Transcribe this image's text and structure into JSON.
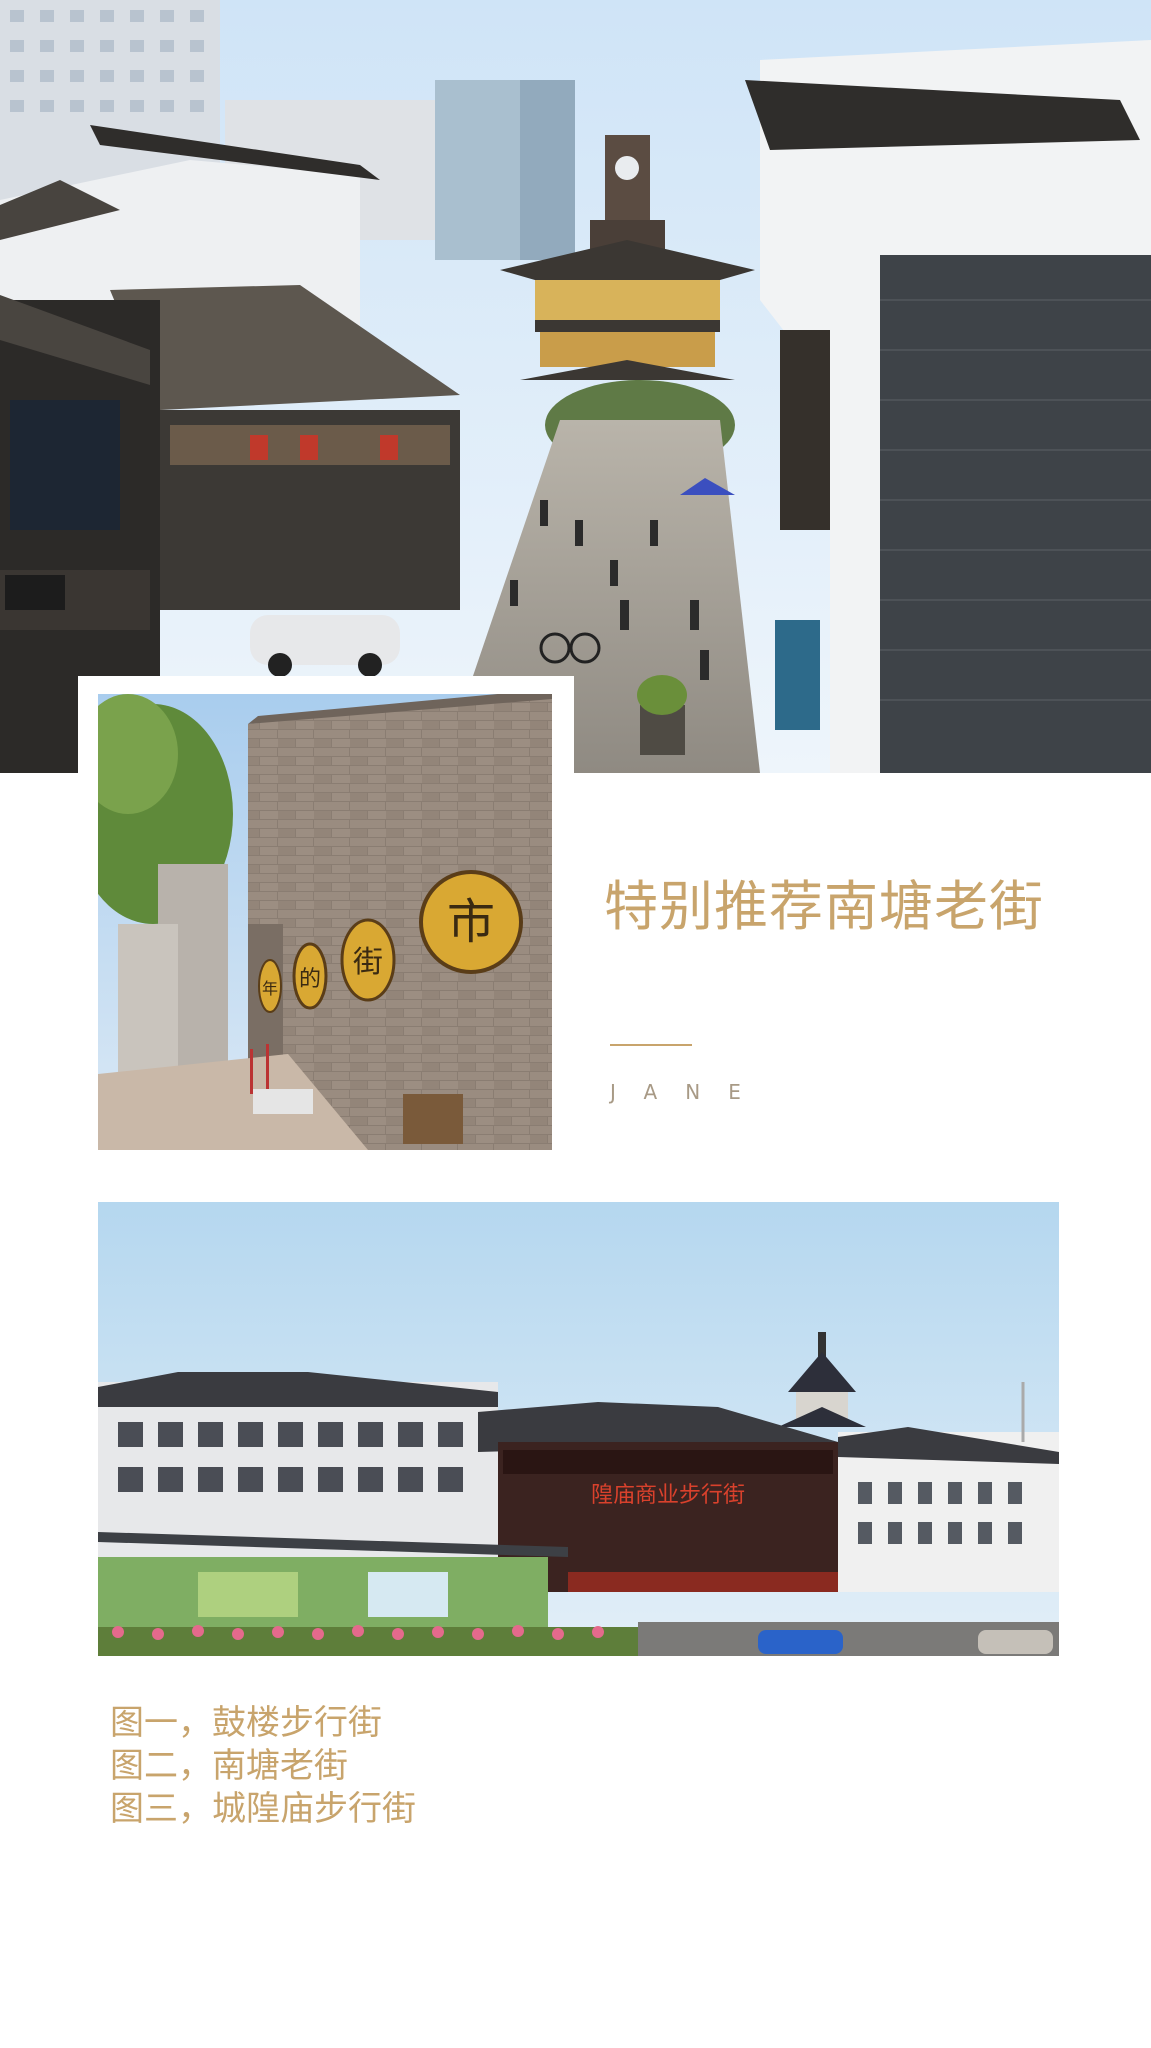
{
  "article": {
    "title": "特别推荐南塘老街",
    "author": "JANE",
    "captions": [
      "图一，鼓楼步行街",
      "图二，南塘老街",
      "图三，城隍庙步行街"
    ]
  },
  "photos": {
    "photo_1": {
      "sign_text": ""
    },
    "photo_2": {
      "wall_characters": [
        "市",
        "街",
        "的",
        "年"
      ]
    },
    "photo_3": {
      "sign_text": "隍庙商业步行街"
    }
  },
  "colors": {
    "accent": "#c8a46c",
    "author_gray": "#a89a86",
    "background": "#ffffff"
  }
}
